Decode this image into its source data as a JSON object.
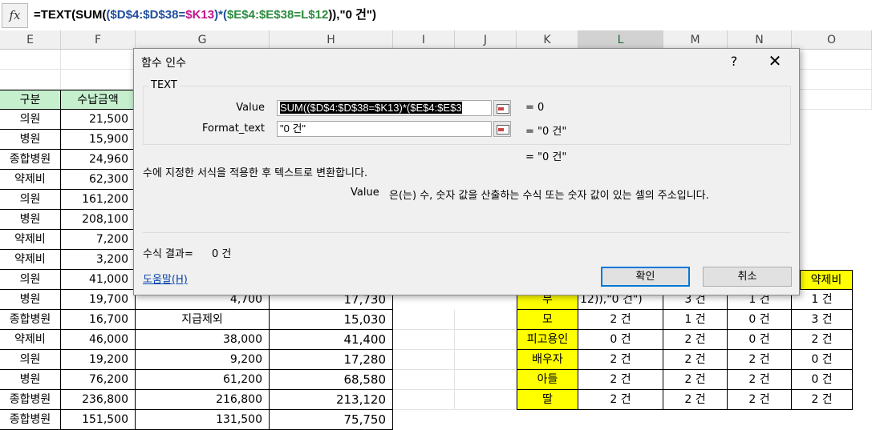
{
  "formula_bar": {
    "fx_label": "fx",
    "p_eq": "=TEXT(SUM(",
    "p_open": "(",
    "p_range1": "$D$4:$D$38",
    "p_eq2": "=",
    "p_k13": "$K13",
    "p_close_mul": ")*(",
    "p_range2": "$E$4:$E$38",
    "p_eq3": "=",
    "p_l12": "L$12",
    "p_tail": ")),\"0 건\")"
  },
  "columns": [
    "E",
    "F",
    "G",
    "H",
    "I",
    "J",
    "K",
    "L",
    "M",
    "N",
    "O"
  ],
  "sheet_left": {
    "header_category": "구분",
    "header_amount": "수납금액",
    "rows": [
      {
        "cat": "의원",
        "amt": "21,500"
      },
      {
        "cat": "병원",
        "amt": "15,900"
      },
      {
        "cat": "종합병원",
        "amt": "24,960"
      },
      {
        "cat": "약제비",
        "amt": "62,300"
      },
      {
        "cat": "의원",
        "amt": "161,200"
      },
      {
        "cat": "병원",
        "amt": "208,100"
      },
      {
        "cat": "약제비",
        "amt": "7,200"
      },
      {
        "cat": "약제비",
        "amt": "3,200"
      },
      {
        "cat": "의원",
        "amt": "41,000"
      },
      {
        "cat": "병원",
        "amt": "19,700",
        "g": "4,700",
        "h": "17,730"
      },
      {
        "cat": "종합병원",
        "amt": "16,700",
        "g": "지급제외",
        "h": "15,030"
      },
      {
        "cat": "약제비",
        "amt": "46,000",
        "g": "38,000",
        "h": "41,400"
      },
      {
        "cat": "의원",
        "amt": "19,200",
        "g": "9,200",
        "h": "17,280"
      },
      {
        "cat": "병원",
        "amt": "76,200",
        "g": "61,200",
        "h": "68,580"
      },
      {
        "cat": "종합병원",
        "amt": "236,800",
        "g": "216,800",
        "h": "213,120"
      },
      {
        "cat": "종합병원",
        "amt": "151,500",
        "g": "131,500",
        "h": "75,750"
      }
    ]
  },
  "sheet_right": {
    "o_header": "약제비",
    "rows": [
      {
        "k": "부",
        "l": "12)),\"0 건\")",
        "m": "3 건",
        "n": "1 건",
        "o": "1 건"
      },
      {
        "k": "모",
        "l": "2 건",
        "m": "1 건",
        "n": "0 건",
        "o": "3 건"
      },
      {
        "k": "피고용인",
        "l": "0 건",
        "m": "2 건",
        "n": "0 건",
        "o": "2 건"
      },
      {
        "k": "배우자",
        "l": "2 건",
        "m": "2 건",
        "n": "2 건",
        "o": "0 건"
      },
      {
        "k": "아들",
        "l": "2 건",
        "m": "2 건",
        "n": "2 건",
        "o": "0 건"
      },
      {
        "k": "딸",
        "l": "2 건",
        "m": "2 건",
        "n": "2 건",
        "o": "2 건"
      }
    ]
  },
  "dialog": {
    "title": "함수 인수",
    "help_glyph": "?",
    "close_glyph": "✕",
    "function_name": "TEXT",
    "arg1_label": "Value",
    "arg1_value": "SUM(($D$4:$D$38=$K13)*($E$4:$E$3",
    "arg1_result": "=  0",
    "arg2_label": "Format_text",
    "arg2_value": "\"0 건\"",
    "arg2_result": "=  \"0 건\"",
    "total_result": "=  \"0 건\"",
    "description": "수에 지정한 서식을 적용한 후 텍스트로 변환합니다.",
    "arg_help_name": "Value",
    "arg_help_text": "은(는) 수, 숫자 값을 산출하는 수식 또는 숫자 값이 있는 셀의 주소입니다.",
    "formula_result_label": "수식 결과=",
    "formula_result_value": "0 건",
    "help_link": "도움말(H)",
    "ok_label": "확인",
    "cancel_label": "취소"
  },
  "colors": {
    "header_green": "#c6efce",
    "highlight_yellow": "#ffff00",
    "accent_blue": "#0078d7"
  }
}
